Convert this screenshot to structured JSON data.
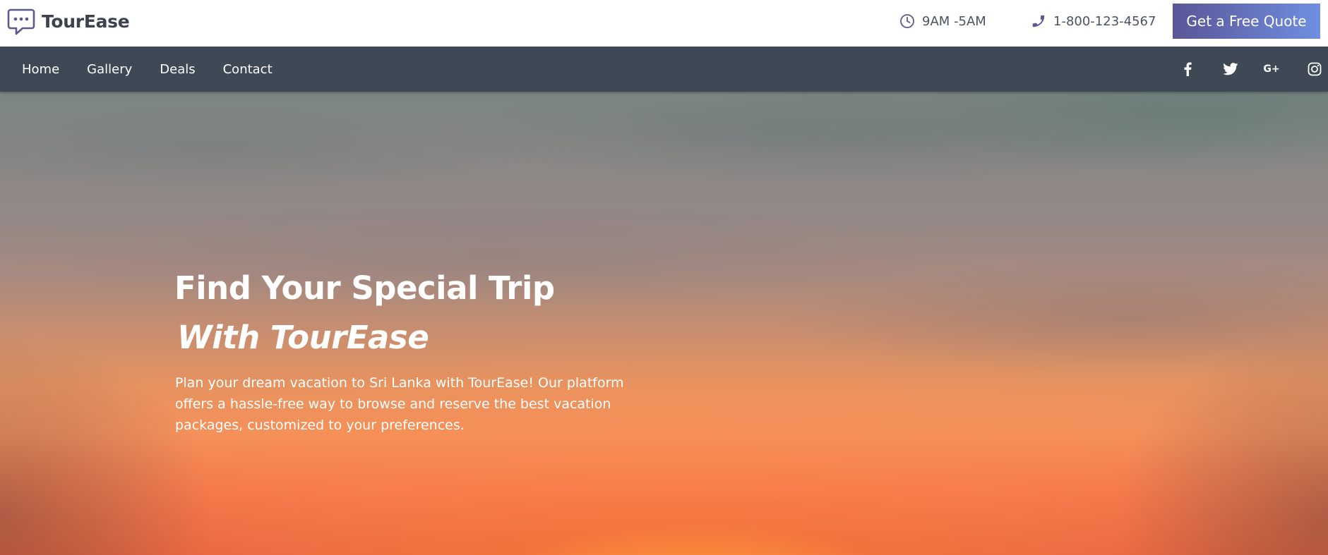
{
  "brand": {
    "name": "TourEase",
    "icon": "chat-bubble-icon"
  },
  "header": {
    "hours": {
      "text": "9AM -5AM",
      "icon": "clock-icon"
    },
    "phone": {
      "text": "1-800-123-4567",
      "icon": "phone-icon"
    },
    "cta_label": "Get a Free Quote"
  },
  "nav": {
    "items": [
      {
        "label": "Home"
      },
      {
        "label": "Gallery"
      },
      {
        "label": "Deals"
      },
      {
        "label": "Contact"
      }
    ],
    "social": [
      {
        "name": "facebook",
        "icon": "facebook-icon"
      },
      {
        "name": "twitter",
        "icon": "twitter-icon"
      },
      {
        "name": "google-plus",
        "icon": "google-plus-icon",
        "glyph": "G+"
      },
      {
        "name": "instagram",
        "icon": "instagram-icon"
      }
    ]
  },
  "hero": {
    "title_line1": "Find Your Special Trip",
    "title_line2": "With TourEase",
    "description": "Plan your dream vacation to Sri Lanka with TourEase! Our platform offers a hassle-free way to browse and reserve the best vacation packages, customized to your preferences."
  },
  "colors": {
    "brand_text": "#3d4150",
    "navbar_bg": "#3f4855",
    "cta_gradient_start": "#5a5597",
    "cta_gradient_end": "#6f8fe0",
    "icon_accent": "#5a5a8f"
  }
}
